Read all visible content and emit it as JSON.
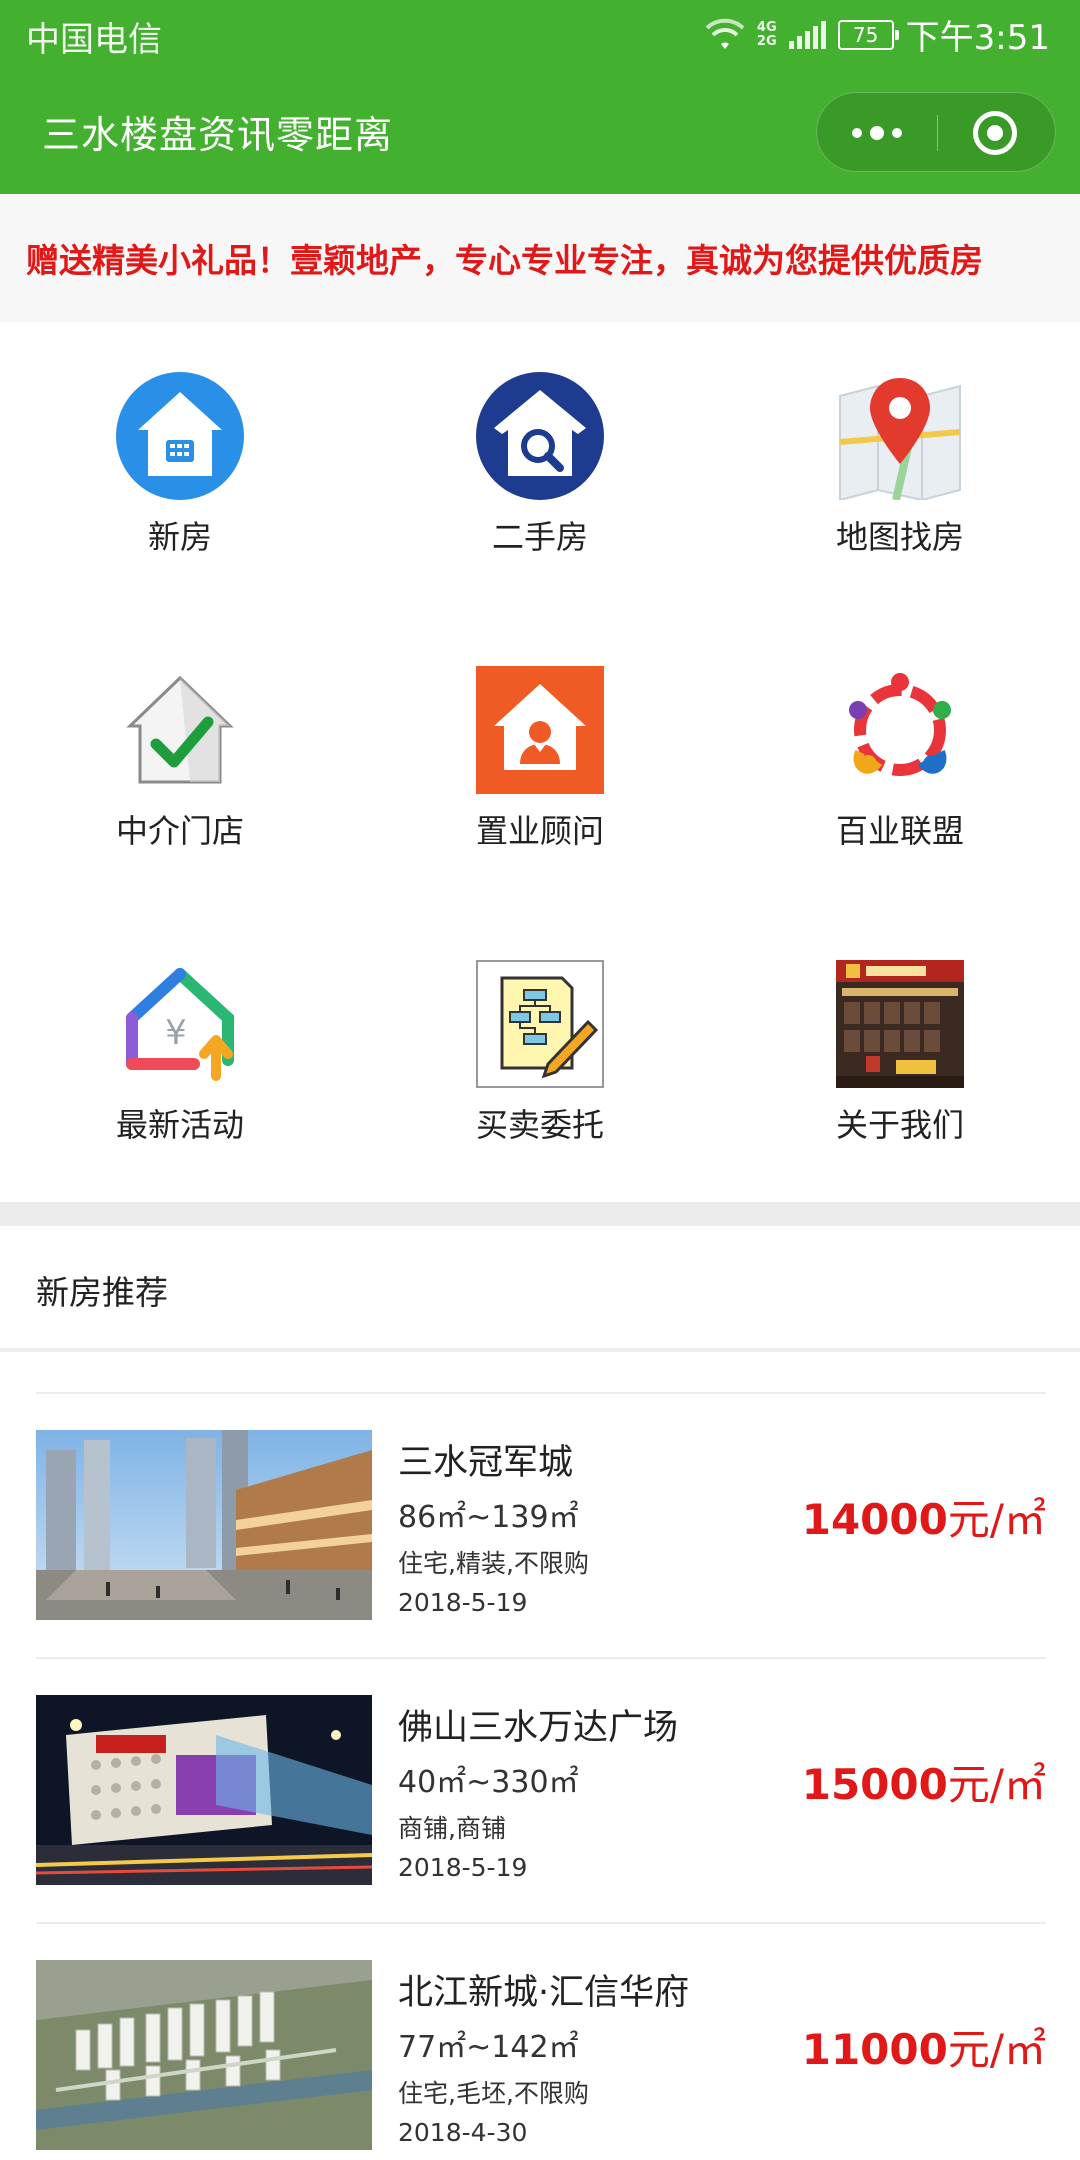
{
  "status_bar": {
    "carrier": "中国电信",
    "network_top": "4G",
    "network_bottom": "2G",
    "battery": "75",
    "time": "下午3:51"
  },
  "navbar": {
    "title": "三水楼盘资讯零距离"
  },
  "marquee": {
    "text": "赠送精美小礼品！壹颖地产，专心专业专注，真诚为您提供优质房"
  },
  "menu": [
    {
      "label": "新房",
      "icon": "house-icon"
    },
    {
      "label": "二手房",
      "icon": "house-search-icon"
    },
    {
      "label": "地图找房",
      "icon": "map-pin-icon"
    },
    {
      "label": "中介门店",
      "icon": "house-check-icon"
    },
    {
      "label": "置业顾问",
      "icon": "consultant-icon"
    },
    {
      "label": "百业联盟",
      "icon": "alliance-icon"
    },
    {
      "label": "最新活动",
      "icon": "activity-icon"
    },
    {
      "label": "买卖委托",
      "icon": "document-pencil-icon"
    },
    {
      "label": "关于我们",
      "icon": "storefront-photo-icon"
    }
  ],
  "section": {
    "title": "新房推荐"
  },
  "listings": [
    {
      "name": "三水冠军城",
      "area": "86㎡~139㎡",
      "tags": "住宅,精装,不限购",
      "date": "2018-5-19",
      "price": "14000",
      "unit": "元/㎡"
    },
    {
      "name": "佛山三水万达广场",
      "area": "40㎡~330㎡",
      "tags": "商铺,商铺",
      "date": "2018-5-19",
      "price": "15000",
      "unit": "元/㎡"
    },
    {
      "name": "北江新城·汇信华府",
      "area": "77㎡~142㎡",
      "tags": "住宅,毛坯,不限购",
      "date": "2018-4-30",
      "price": "11000",
      "unit": "元/㎡"
    }
  ],
  "colors": {
    "brand_green": "#44b02f",
    "price_red": "#e01818"
  }
}
